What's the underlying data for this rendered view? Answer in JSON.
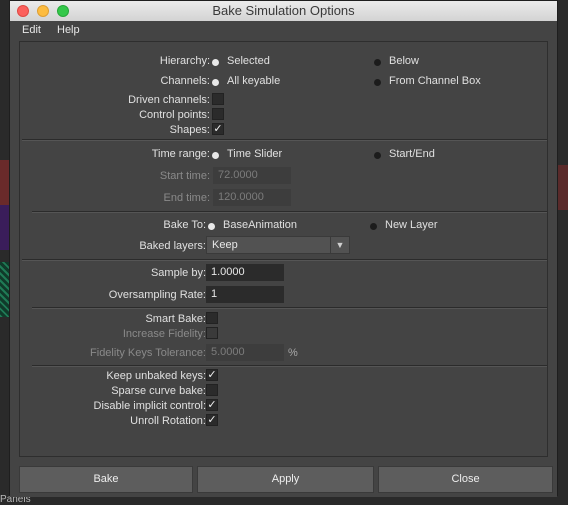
{
  "window": {
    "title": "Bake Simulation Options"
  },
  "menu": {
    "edit": "Edit",
    "help": "Help"
  },
  "hierarchy": {
    "label": "Hierarchy:",
    "opt1": "Selected",
    "opt2": "Below",
    "selected": "Selected"
  },
  "channels": {
    "label": "Channels:",
    "opt1": "All keyable",
    "opt2": "From Channel Box",
    "selected": "All keyable"
  },
  "driven_channels": {
    "label": "Driven channels:",
    "checked": false
  },
  "control_points": {
    "label": "Control points:",
    "checked": false
  },
  "shapes": {
    "label": "Shapes:",
    "checked": true,
    "mark": "✓"
  },
  "time_range": {
    "label": "Time range:",
    "opt1": "Time Slider",
    "opt2": "Start/End",
    "selected": "Time Slider"
  },
  "start_time": {
    "label": "Start time:",
    "value": "72.0000"
  },
  "end_time": {
    "label": "End time:",
    "value": "120.0000"
  },
  "bake_to": {
    "label": "Bake To:",
    "opt1": "BaseAnimation",
    "opt2": "New Layer",
    "selected": "BaseAnimation"
  },
  "baked_layers": {
    "label": "Baked layers:",
    "value": "Keep",
    "arrow": "▼"
  },
  "sample_by": {
    "label": "Sample by:",
    "value": "1.0000"
  },
  "oversampling": {
    "label": "Oversampling Rate:",
    "value": "1"
  },
  "smart_bake": {
    "label": "Smart Bake:",
    "checked": false
  },
  "increase_fidelity": {
    "label": "Increase Fidelity:",
    "checked": false
  },
  "fidelity_tol": {
    "label": "Fidelity Keys Tolerance:",
    "value": "5.0000",
    "unit": "%"
  },
  "keep_unbaked": {
    "label": "Keep unbaked keys:",
    "checked": true,
    "mark": "✓"
  },
  "sparse_curve": {
    "label": "Sparse curve bake:",
    "checked": false
  },
  "disable_implicit": {
    "label": "Disable implicit control:",
    "checked": true,
    "mark": "✓"
  },
  "unroll_rotation": {
    "label": "Unroll Rotation:",
    "checked": true,
    "mark": "✓"
  },
  "buttons": {
    "bake": "Bake",
    "apply": "Apply",
    "close": "Close"
  },
  "background": {
    "panels_label": "Panels"
  },
  "colors": {
    "window_bg": "#444444",
    "field_bg": "#2b2b2b",
    "button_bg": "#5d5d5d",
    "titlebar": "#d3d3d3"
  }
}
